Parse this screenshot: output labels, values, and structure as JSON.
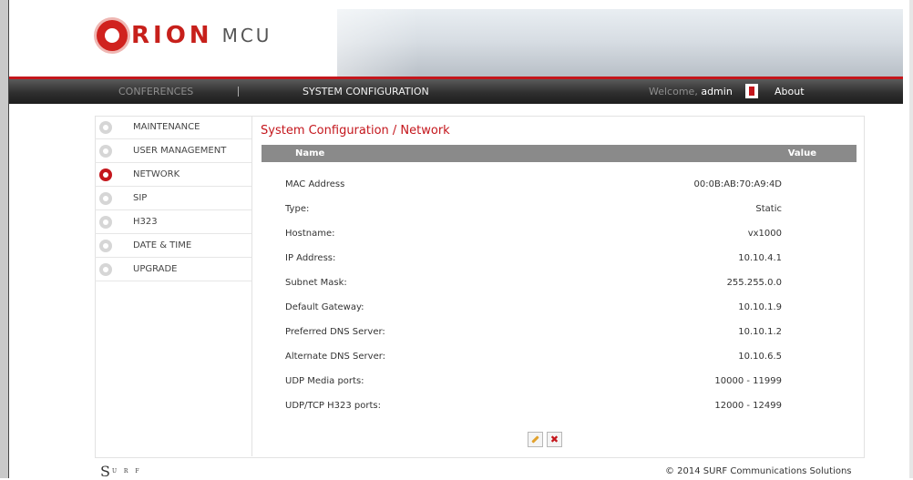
{
  "app": {
    "logo_text": "RION",
    "logo_sub": "MCU"
  },
  "nav": {
    "conferences": "CONFERENCES",
    "system_configuration": "SYSTEM CONFIGURATION",
    "welcome": "Welcome,",
    "user": "admin",
    "about": "About"
  },
  "sidebar": {
    "items": [
      {
        "label": "MAINTENANCE",
        "active": false
      },
      {
        "label": "USER MANAGEMENT",
        "active": false
      },
      {
        "label": "NETWORK",
        "active": true
      },
      {
        "label": "SIP",
        "active": false
      },
      {
        "label": "H323",
        "active": false
      },
      {
        "label": "DATE & TIME",
        "active": false
      },
      {
        "label": "UPGRADE",
        "active": false
      }
    ]
  },
  "main": {
    "title": "System Configuration / Network",
    "columns": {
      "name": "Name",
      "value": "Value"
    },
    "rows": [
      {
        "name": "MAC Address",
        "value": "00:0B:AB:70:A9:4D"
      },
      {
        "name": "Type:",
        "value": "Static"
      },
      {
        "name": "Hostname:",
        "value": "vx1000"
      },
      {
        "name": "IP Address:",
        "value": "10.10.4.1"
      },
      {
        "name": "Subnet Mask:",
        "value": "255.255.0.0"
      },
      {
        "name": "Default Gateway:",
        "value": "10.10.1.9"
      },
      {
        "name": "Preferred DNS Server:",
        "value": "10.10.1.2"
      },
      {
        "name": "Alternate DNS Server:",
        "value": "10.10.6.5"
      },
      {
        "name": "UDP Media ports:",
        "value": "10000 - 11999"
      },
      {
        "name": "UDP/TCP H323 ports:",
        "value": "12000 - 12499"
      }
    ],
    "actions": {
      "edit_icon": "edit-icon",
      "cancel_icon": "cancel-icon",
      "cancel_glyph": "✖"
    }
  },
  "footer": {
    "logo_initial": "S",
    "logo_text": "U R F",
    "copyright": "© 2014 SURF Communications Solutions"
  },
  "colors": {
    "accent": "#c4161c",
    "navbar": "#2f2f2f",
    "table_header": "#8a8a8a"
  }
}
